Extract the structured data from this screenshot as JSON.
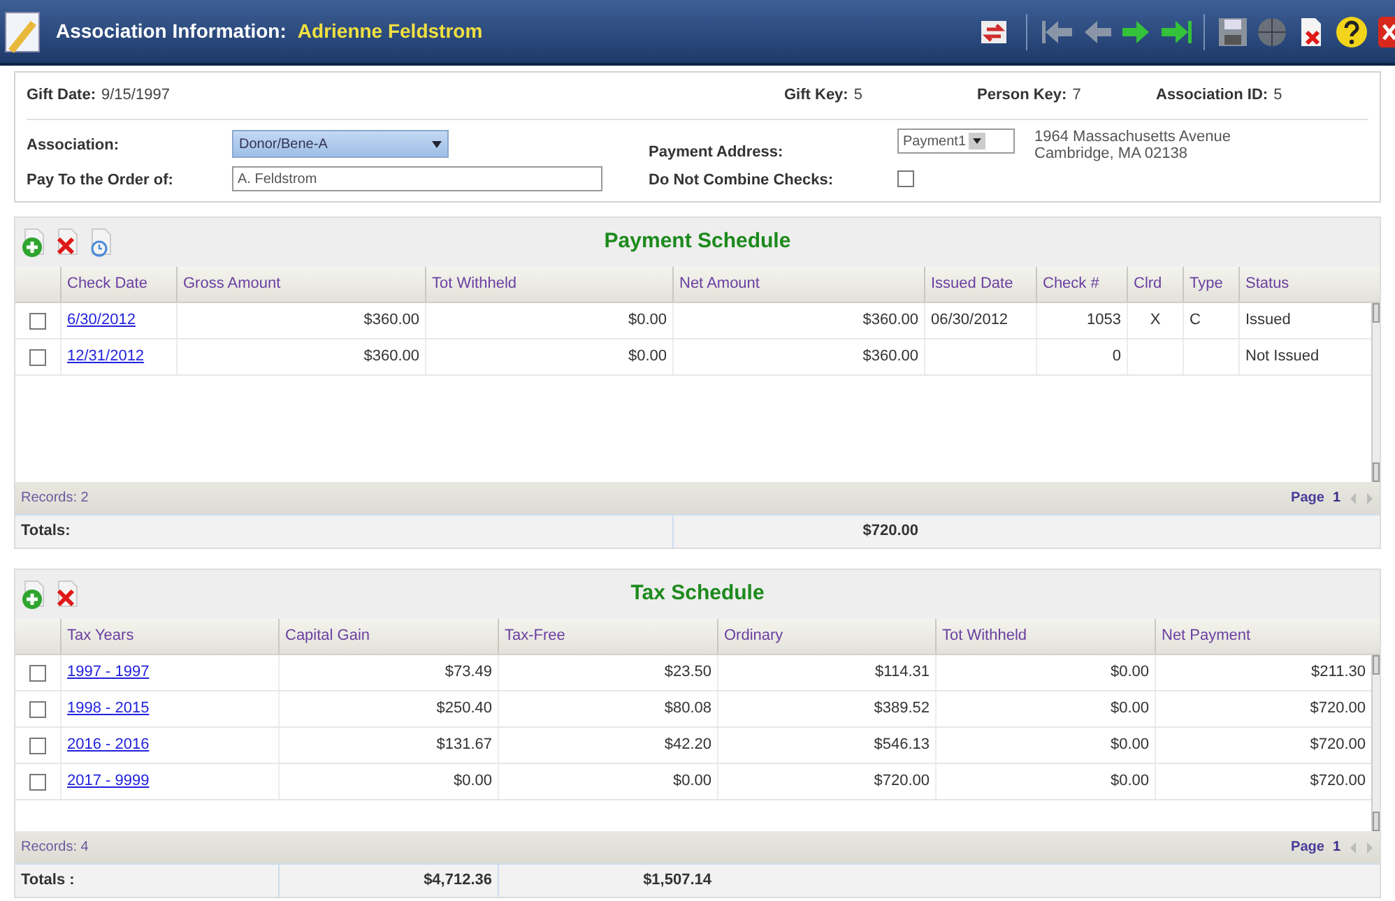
{
  "header": {
    "title": "Association Information:",
    "name": "Adrienne Feldstrom"
  },
  "info": {
    "gift_date": {
      "label": "Gift Date:",
      "value": "9/15/1997"
    },
    "gift_key": {
      "label": "Gift Key:",
      "value": "5"
    },
    "person_key": {
      "label": "Person Key:",
      "value": "7"
    },
    "association_id": {
      "label": "Association ID:",
      "value": "5"
    },
    "association": {
      "label": "Association:",
      "value": "Donor/Bene-A"
    },
    "pay_to": {
      "label": "Pay To the Order of:",
      "value": "A. Feldstrom"
    },
    "payment_address": {
      "label": "Payment Address:",
      "value": "Payment1",
      "address_lines": [
        "1964 Massachusetts Avenue",
        "Cambridge, MA 02138"
      ]
    },
    "do_not_combine": {
      "label": "Do Not Combine Checks:",
      "checked": false
    }
  },
  "tables": [
    {
      "title": "Payment Schedule",
      "tools": [
        {
          "kind": "add"
        },
        {
          "kind": "delete"
        },
        {
          "kind": "view"
        }
      ],
      "columns": [
        {
          "label": "Check Date",
          "kind": "link"
        },
        {
          "label": "Gross Amount",
          "kind": "money"
        },
        {
          "label": "Tot Withheld",
          "kind": "money"
        },
        {
          "label": "Net Amount",
          "kind": "money",
          "total": "$720.00"
        },
        {
          "label": "Issued Date",
          "kind": "text"
        },
        {
          "label": "Check #",
          "kind": "money"
        },
        {
          "label": "Clrd",
          "kind": "center"
        },
        {
          "label": "Type",
          "kind": "text"
        },
        {
          "label": "Status",
          "kind": "text"
        }
      ],
      "rows": [
        {
          "checked": false,
          "cells": [
            "6/30/2012",
            "$360.00",
            "$0.00",
            "$360.00",
            "06/30/2012",
            "1053",
            "X",
            "C",
            "Issued"
          ]
        },
        {
          "checked": false,
          "cells": [
            "12/31/2012",
            "$360.00",
            "$0.00",
            "$360.00",
            "",
            "0",
            "",
            "",
            "Not Issued"
          ]
        }
      ],
      "records": "Records: 2",
      "page_label": "Page",
      "page": "1",
      "totals_label": "Totals:"
    },
    {
      "title": "Tax Schedule",
      "tools": [
        {
          "kind": "add"
        },
        {
          "kind": "delete"
        }
      ],
      "columns": [
        {
          "label": "Tax Years",
          "kind": "link"
        },
        {
          "label": "Capital Gain",
          "kind": "money",
          "total": "$4,712.36"
        },
        {
          "label": "Tax-Free",
          "kind": "money",
          "total": "$1,507.14"
        },
        {
          "label": "Ordinary",
          "kind": "money"
        },
        {
          "label": "Tot Withheld",
          "kind": "money"
        },
        {
          "label": "Net Payment",
          "kind": "money"
        }
      ],
      "rows": [
        {
          "checked": false,
          "cells": [
            "1997 - 1997",
            "$73.49",
            "$23.50",
            "$114.31",
            "$0.00",
            "$211.30"
          ]
        },
        {
          "checked": false,
          "cells": [
            "1998 - 2015",
            "$250.40",
            "$80.08",
            "$389.52",
            "$0.00",
            "$720.00"
          ]
        },
        {
          "checked": false,
          "cells": [
            "2016 - 2016",
            "$131.67",
            "$42.20",
            "$546.13",
            "$0.00",
            "$720.00"
          ]
        },
        {
          "checked": false,
          "cells": [
            "2017 - 9999",
            "$0.00",
            "$0.00",
            "$720.00",
            "$0.00",
            "$720.00"
          ]
        }
      ],
      "records": "Records: 4",
      "page_label": "Page",
      "page": "1",
      "totals_label": "Totals :"
    }
  ]
}
